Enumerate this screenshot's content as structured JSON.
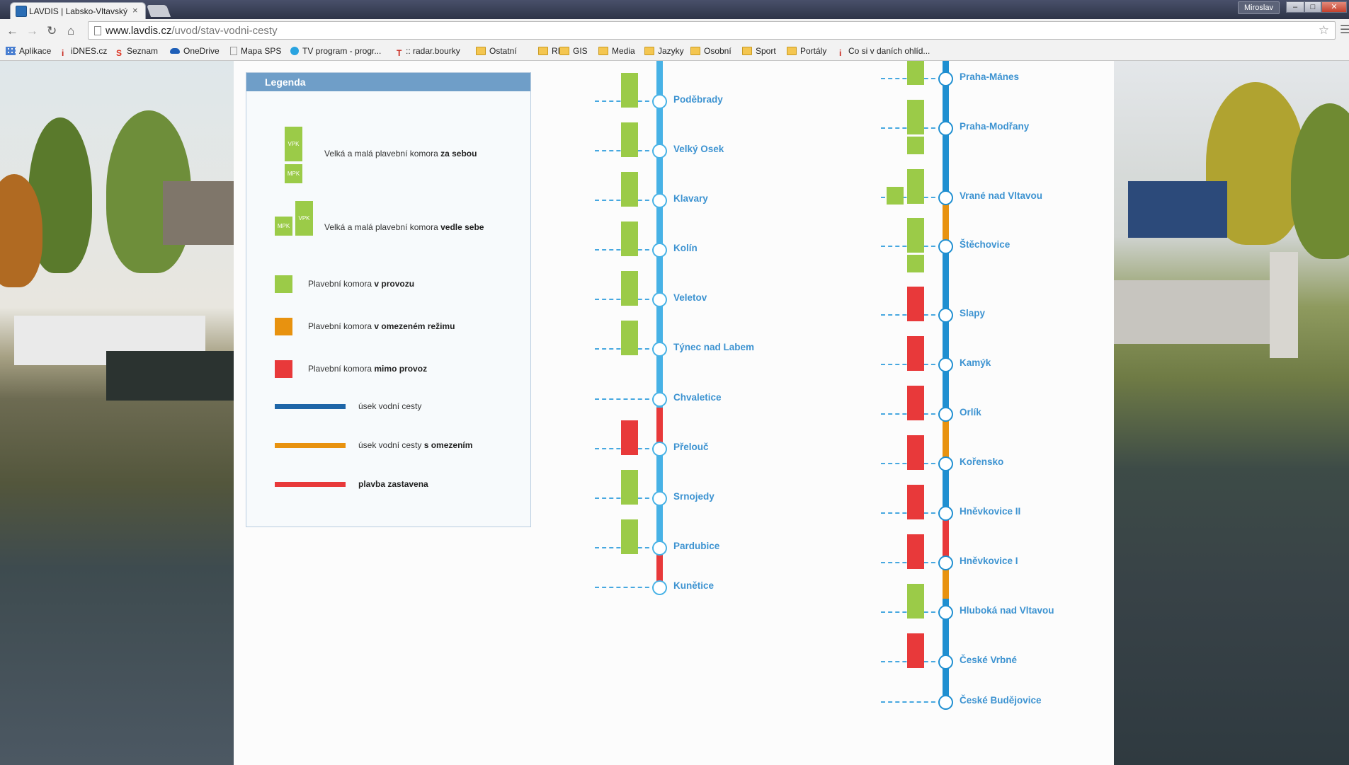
{
  "browser": {
    "tab_title": "LAVDIS | Labsko-Vltavský",
    "tab_close": "×",
    "user_label": "Miroslav",
    "url_host": "www.lavdis.cz",
    "url_path": "/uvod/stav-vodni-cesty",
    "window_buttons": [
      "–",
      "□",
      "✕"
    ]
  },
  "bookmarks": [
    {
      "label": "Aplikace",
      "icon": "apps-grid-icon"
    },
    {
      "label": "iDNES.cz",
      "icon": "idnes-icon"
    },
    {
      "label": "Seznam",
      "icon": "seznam-icon"
    },
    {
      "label": "OneDrive",
      "icon": "cloud-icon"
    },
    {
      "label": "Mapa SPS",
      "icon": "page-icon"
    },
    {
      "label": "TV program - progr...",
      "icon": "tv-icon"
    },
    {
      "label": ":: radar.bourky",
      "icon": "radar-icon"
    },
    {
      "label": "Ostatní",
      "icon": "folder-icon"
    },
    {
      "label": "RIS",
      "icon": "folder-icon"
    },
    {
      "label": "GIS",
      "icon": "folder-icon"
    },
    {
      "label": "Media",
      "icon": "folder-icon"
    },
    {
      "label": "Jazyky",
      "icon": "folder-icon"
    },
    {
      "label": "Osobní",
      "icon": "folder-icon"
    },
    {
      "label": "Sport",
      "icon": "folder-icon"
    },
    {
      "label": "Portály",
      "icon": "folder-icon"
    },
    {
      "label": "Co si v daních ohlíd...",
      "icon": "idnes-icon"
    }
  ],
  "legend": {
    "title": "Legenda",
    "vpk": "VPK",
    "mpk": "MPK",
    "items": [
      {
        "pre": "Velká a malá plavební komora ",
        "bold": "za sebou"
      },
      {
        "pre": "Velká a malá plavební komora ",
        "bold": "vedle sebe"
      },
      {
        "pre": "Plavební komora ",
        "bold": "v provozu"
      },
      {
        "pre": "Plavební komora ",
        "bold": "v omezeném režimu"
      },
      {
        "pre": "Plavební komora ",
        "bold": "mimo provoz"
      },
      {
        "pre": "úsek vodní cesty",
        "bold": ""
      },
      {
        "pre": "úsek vodní cesty ",
        "bold": "s omezením"
      },
      {
        "pre": "",
        "bold": "plavba zastavena"
      }
    ]
  },
  "colors": {
    "in_operation": "#9bcb48",
    "restricted": "#e8920f",
    "out_of_service": "#e8393a",
    "waterway": "#1e66a8",
    "river_line": "#47b2e6",
    "river_line_dark": "#1f8fd1"
  },
  "elbe": {
    "stations": [
      {
        "name": "Poděbrady",
        "locks": [
          "green"
        ]
      },
      {
        "name": "Velký Osek",
        "locks": [
          "green"
        ]
      },
      {
        "name": "Klavary",
        "locks": [
          "green"
        ]
      },
      {
        "name": "Kolín",
        "locks": [
          "green"
        ]
      },
      {
        "name": "Veletov",
        "locks": [
          "green"
        ]
      },
      {
        "name": "Týnec nad Labem",
        "locks": [
          "green"
        ]
      },
      {
        "name": "Chvaletice",
        "locks": []
      },
      {
        "name": "Přelouč",
        "locks": [
          "red"
        ]
      },
      {
        "name": "Srnojedy",
        "locks": [
          "green"
        ]
      },
      {
        "name": "Pardubice",
        "locks": [
          "green"
        ]
      },
      {
        "name": "Kunětice",
        "locks": []
      }
    ]
  },
  "vltava": {
    "stations": [
      {
        "name": "Praha-Mánes",
        "locks": [
          "green"
        ]
      },
      {
        "name": "Praha-Modřany",
        "locks": [
          "green-stack"
        ]
      },
      {
        "name": "Vrané nad Vltavou",
        "locks": [
          "green-side"
        ]
      },
      {
        "name": "Štěchovice",
        "locks": [
          "green-stack"
        ]
      },
      {
        "name": "Slapy",
        "locks": [
          "red"
        ]
      },
      {
        "name": "Kamýk",
        "locks": [
          "red"
        ]
      },
      {
        "name": "Orlík",
        "locks": [
          "red"
        ]
      },
      {
        "name": "Kořensko",
        "locks": [
          "red"
        ]
      },
      {
        "name": "Hněvkovice II",
        "locks": [
          "red"
        ]
      },
      {
        "name": "Hněvkovice I",
        "locks": [
          "red"
        ]
      },
      {
        "name": "Hluboká nad Vltavou",
        "locks": [
          "green"
        ]
      },
      {
        "name": "České Vrbné",
        "locks": [
          "red"
        ]
      },
      {
        "name": "České Budějovice",
        "locks": []
      }
    ]
  }
}
